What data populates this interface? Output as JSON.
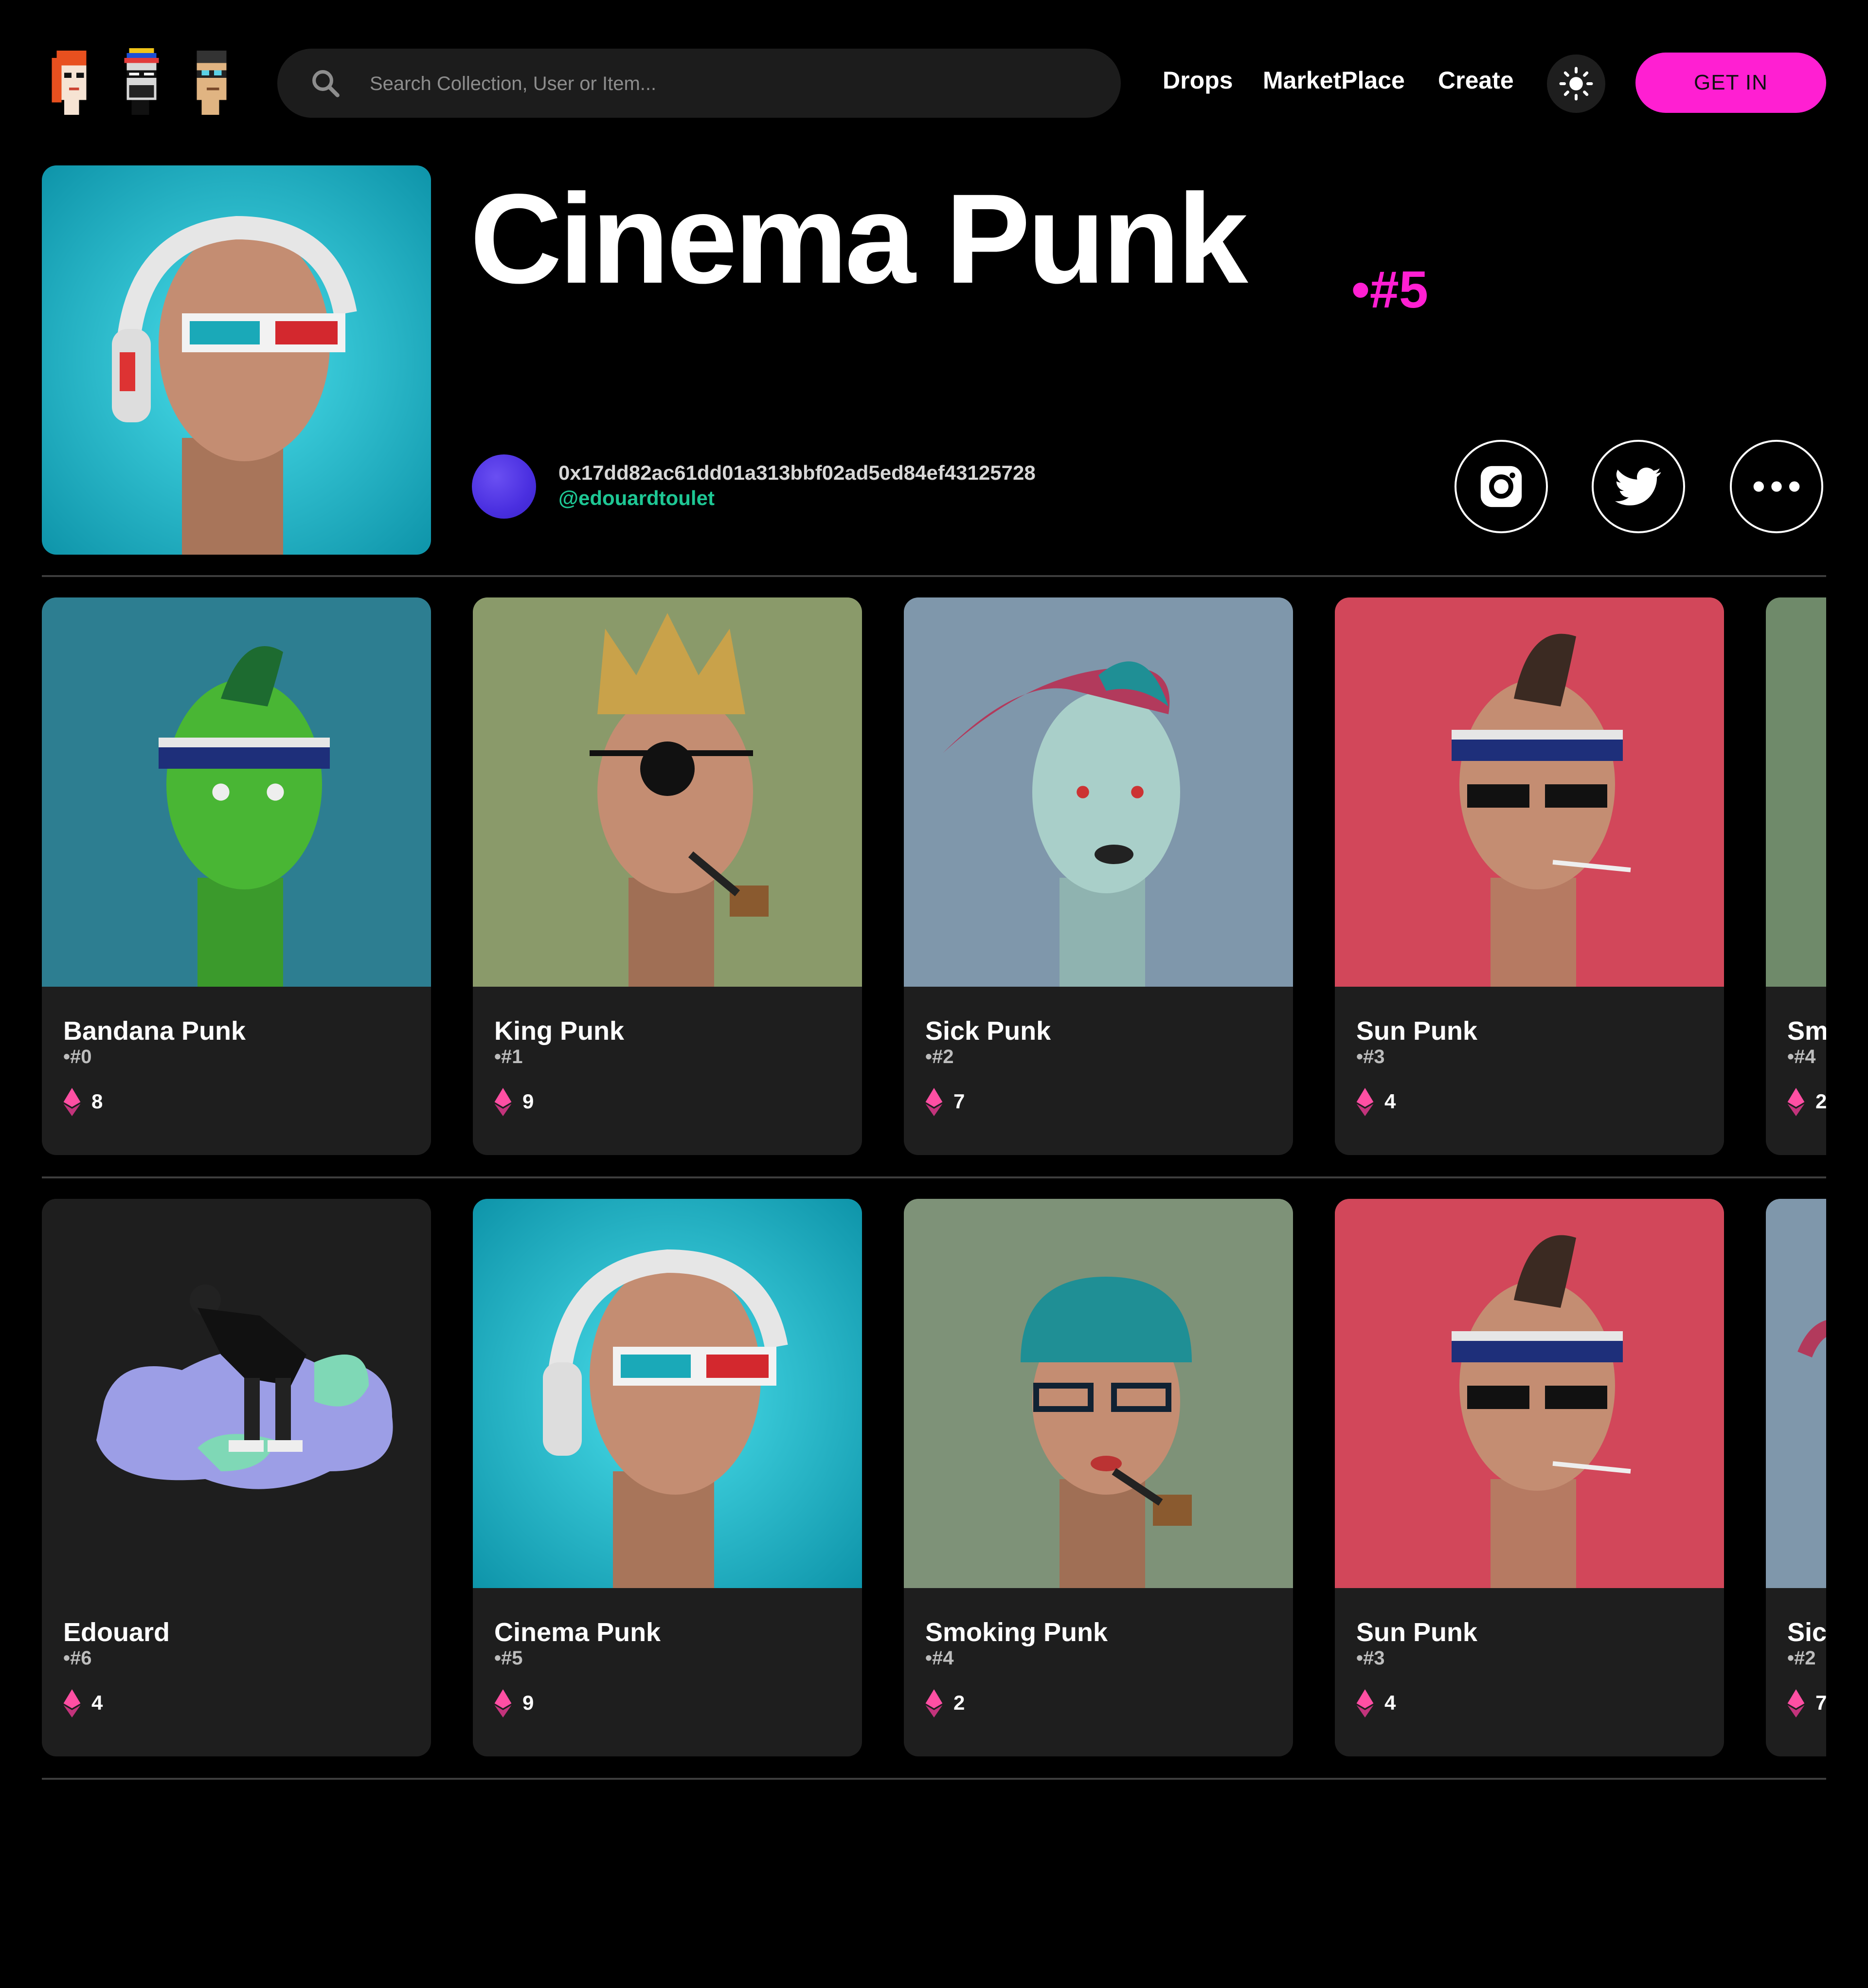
{
  "header": {
    "logo_alt": "Punk avatars",
    "search_placeholder": "Search Collection, User or Item...",
    "nav": [
      "Drops",
      "MarketPlace",
      "Create"
    ],
    "get_in_label": "GET IN",
    "accent_color": "#ff1fd2"
  },
  "hero": {
    "title": "Cinema Punk",
    "token_id": "•#5",
    "owner_address": "0x17dd82ac61dd01a313bbf02ad5ed84ef43125728",
    "owner_handle": "@edouardtoulet",
    "social_icons": [
      "instagram-icon",
      "twitter-icon",
      "more-icon"
    ]
  },
  "rows": [
    [
      {
        "name": "Bandana Punk",
        "id": "•#0",
        "price": "8"
      },
      {
        "name": "King Punk",
        "id": "•#1",
        "price": "9"
      },
      {
        "name": "Sick Punk",
        "id": "•#2",
        "price": "7"
      },
      {
        "name": "Sun Punk",
        "id": "•#3",
        "price": "4"
      },
      {
        "name": "Sm",
        "id": "•#4",
        "price": "2"
      }
    ],
    [
      {
        "name": "Edouard",
        "id": "•#6",
        "price": "4"
      },
      {
        "name": "Cinema Punk",
        "id": "•#5",
        "price": "9"
      },
      {
        "name": "Smoking Punk",
        "id": "•#4",
        "price": "2"
      },
      {
        "name": "Sun Punk",
        "id": "•#3",
        "price": "4"
      },
      {
        "name": "Sic",
        "id": "•#2",
        "price": "7"
      }
    ]
  ]
}
